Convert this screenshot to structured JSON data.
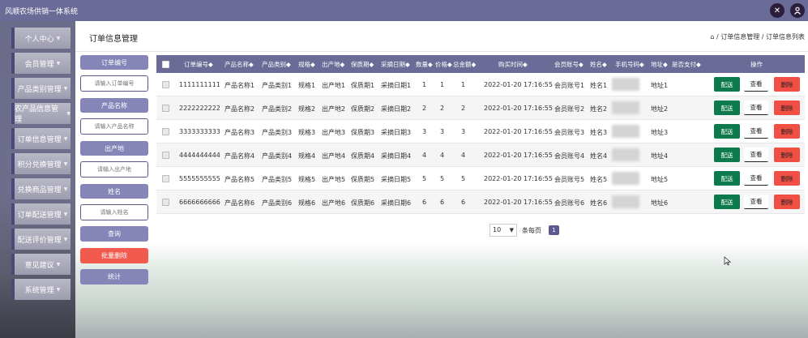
{
  "app_title": "风顺农场供销一体系统",
  "sidebar": {
    "items": [
      {
        "label": "个人中心"
      },
      {
        "label": "会员管理"
      },
      {
        "label": "产品类别管理"
      },
      {
        "label": "农产品信息管理"
      },
      {
        "label": "订单信息管理"
      },
      {
        "label": "积分兑换管理"
      },
      {
        "label": "兑换商品管理"
      },
      {
        "label": "订单配送管理"
      },
      {
        "label": "配送评价管理"
      },
      {
        "label": "意见建议"
      },
      {
        "label": "系统管理"
      }
    ]
  },
  "header": {
    "page_title": "订单信息管理",
    "breadcrumb": "⌂ / 订单信息管理 / 订单信息列表"
  },
  "filters": [
    {
      "label": "订单编号",
      "placeholder": "请输入订单编号"
    },
    {
      "label": "产品名称",
      "placeholder": "请输入产品名称"
    },
    {
      "label": "出产地",
      "placeholder": "请输入出产地"
    },
    {
      "label": "姓名",
      "placeholder": "请输入姓名"
    }
  ],
  "buttons": {
    "search": "查询",
    "batch_delete": "批量删除",
    "stats": "统计"
  },
  "table": {
    "headers": [
      "订单编号◆",
      "产品名称◆",
      "产品类别◆",
      "规格◆",
      "出产地◆",
      "保质期◆",
      "采摘日期◆",
      "数量◆",
      "价格◆",
      "总金额◆",
      "购买时间◆",
      "会员账号◆",
      "姓名◆",
      "手机号码◆",
      "地址◆",
      "是否支付◆",
      "操作"
    ],
    "rows": [
      {
        "order_no": "1111111111",
        "product": "产品名称1",
        "category": "产品类别1",
        "spec": "规格1",
        "origin": "出产地1",
        "shelf": "保质期1",
        "pick_date": "采摘日期1",
        "qty": "1",
        "price": "1",
        "total": "1",
        "buy_time": "2022-01-20 17:16:55",
        "account": "会员账号1",
        "name": "姓名1",
        "phone": "",
        "address": "地址1",
        "paid": ""
      },
      {
        "order_no": "2222222222",
        "product": "产品名称2",
        "category": "产品类别2",
        "spec": "规格2",
        "origin": "出产地2",
        "shelf": "保质期2",
        "pick_date": "采摘日期2",
        "qty": "2",
        "price": "2",
        "total": "2",
        "buy_time": "2022-01-20 17:16:55",
        "account": "会员账号2",
        "name": "姓名2",
        "phone": "",
        "address": "地址2",
        "paid": ""
      },
      {
        "order_no": "3333333333",
        "product": "产品名称3",
        "category": "产品类别3",
        "spec": "规格3",
        "origin": "出产地3",
        "shelf": "保质期3",
        "pick_date": "采摘日期3",
        "qty": "3",
        "price": "3",
        "total": "3",
        "buy_time": "2022-01-20 17:16:55",
        "account": "会员账号3",
        "name": "姓名3",
        "phone": "",
        "address": "地址3",
        "paid": ""
      },
      {
        "order_no": "4444444444",
        "product": "产品名称4",
        "category": "产品类别4",
        "spec": "规格4",
        "origin": "出产地4",
        "shelf": "保质期4",
        "pick_date": "采摘日期4",
        "qty": "4",
        "price": "4",
        "total": "4",
        "buy_time": "2022-01-20 17:16:55",
        "account": "会员账号4",
        "name": "姓名4",
        "phone": "",
        "address": "地址4",
        "paid": ""
      },
      {
        "order_no": "5555555555",
        "product": "产品名称5",
        "category": "产品类别5",
        "spec": "规格5",
        "origin": "出产地5",
        "shelf": "保质期5",
        "pick_date": "采摘日期5",
        "qty": "5",
        "price": "5",
        "total": "5",
        "buy_time": "2022-01-20 17:16:55",
        "account": "会员账号5",
        "name": "姓名5",
        "phone": "",
        "address": "地址5",
        "paid": ""
      },
      {
        "order_no": "6666666666",
        "product": "产品名称6",
        "category": "产品类别6",
        "spec": "规格6",
        "origin": "出产地6",
        "shelf": "保质期6",
        "pick_date": "采摘日期6",
        "qty": "6",
        "price": "6",
        "total": "6",
        "buy_time": "2022-01-20 17:16:55",
        "account": "会员账号6",
        "name": "姓名6",
        "phone": "",
        "address": "地址6",
        "paid": ""
      }
    ],
    "actions": {
      "send": "配送",
      "view": "查看",
      "delete": "删除"
    }
  },
  "pagination": {
    "page_size": "10",
    "per_page_label": "条每页",
    "current_page": "1"
  },
  "icons": {
    "expand": "expand-arrows-icon",
    "user": "user-icon"
  },
  "colors": {
    "primary": "#6b6b97",
    "send": "#0c7a4c",
    "delete": "#f24f44"
  }
}
